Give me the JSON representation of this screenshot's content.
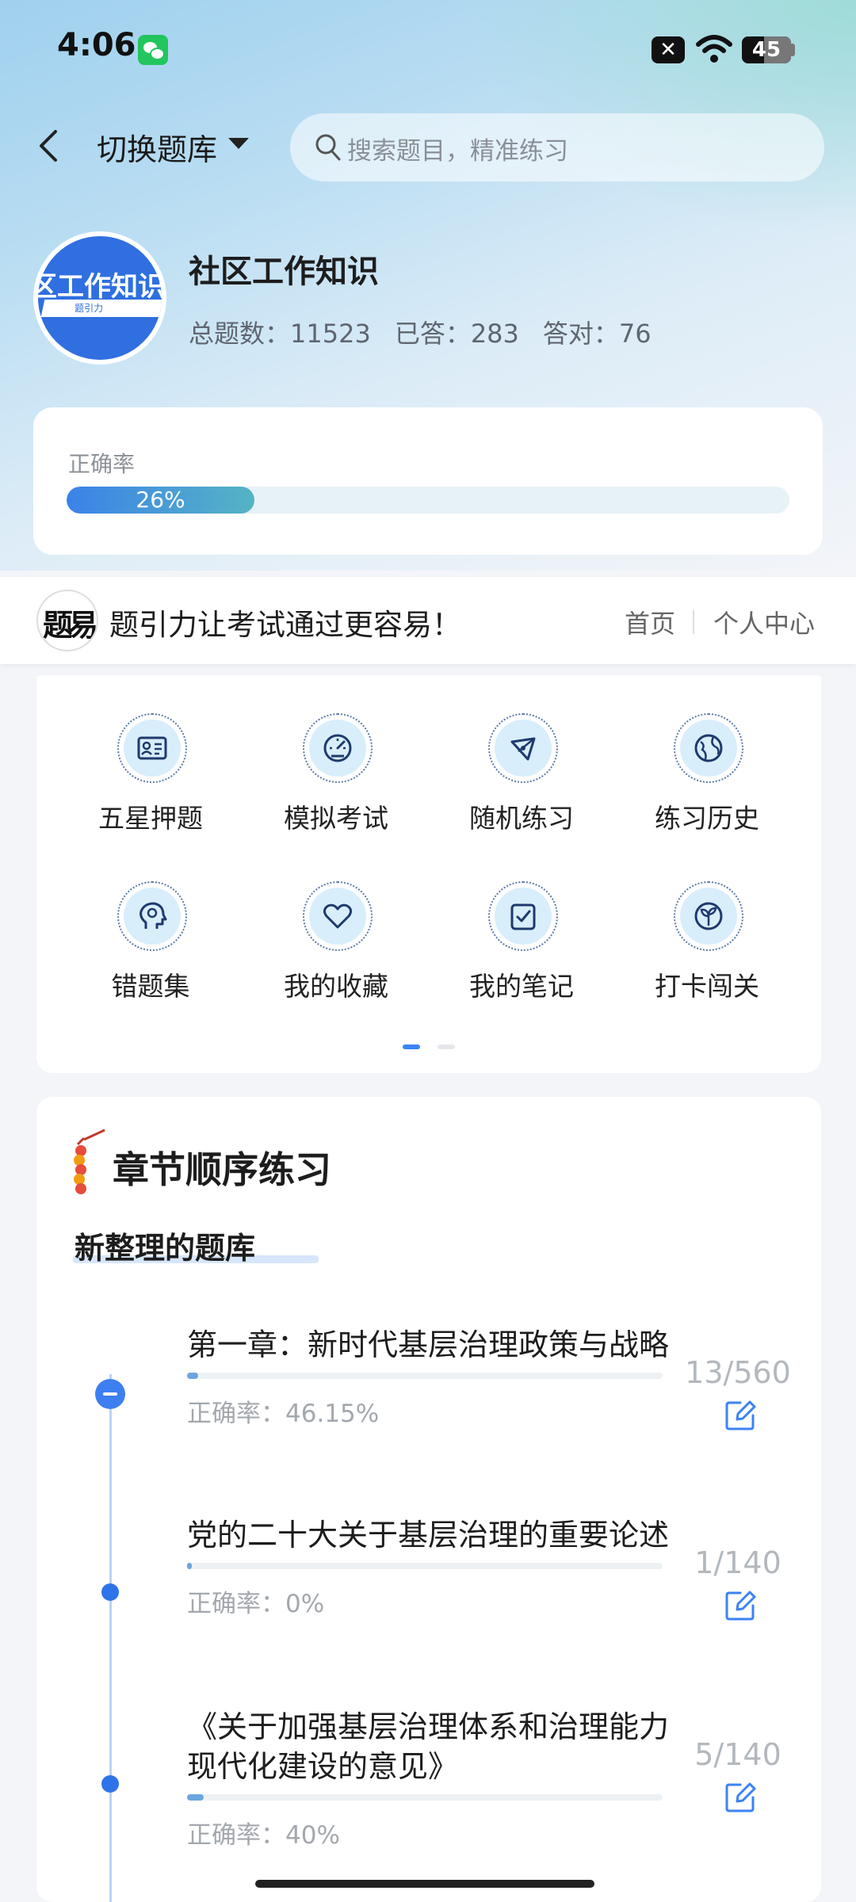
{
  "status_bar": {
    "time": "4:06",
    "battery": "45",
    "notification_x": "✕"
  },
  "nav": {
    "switch_label": "切换题库",
    "search_placeholder": "搜索题目，精准练习"
  },
  "bank": {
    "logo_text": "区工作知识",
    "logo_sub": "题引力",
    "title": "社区工作知识",
    "stats": {
      "total": "总题数：11523",
      "answered": "已答：283",
      "correct": "答对：76"
    }
  },
  "accuracy": {
    "label": "正确率",
    "percent": 26,
    "text": "26%"
  },
  "banner": {
    "logo_glyph": "题易",
    "slogan": "题引力让考试通过更容易！",
    "home": "首页",
    "profile": "个人中心"
  },
  "menu": [
    {
      "label": "五星押题",
      "icon": "id-card-icon"
    },
    {
      "label": "模拟考试",
      "icon": "gauge-icon"
    },
    {
      "label": "随机练习",
      "icon": "random-icon"
    },
    {
      "label": "练习历史",
      "icon": "globe-icon"
    },
    {
      "label": "错题集",
      "icon": "head-icon"
    },
    {
      "label": "我的收藏",
      "icon": "heart-icon"
    },
    {
      "label": "我的笔记",
      "icon": "note-icon"
    },
    {
      "label": "打卡闯关",
      "icon": "sprout-icon"
    }
  ],
  "chapters": {
    "title": "章节顺序练习",
    "subtitle": "新整理的题库",
    "items": [
      {
        "name": "第一章：新时代基层治理政策与战略",
        "count": "13/560",
        "accuracy": "正确率：46.15%",
        "progress": 0.0232
      },
      {
        "name": "党的二十大关于基层治理的重要论述",
        "count": "1/140",
        "accuracy": "正确率：0%",
        "progress": 0.0071
      },
      {
        "name": "《关于加强基层治理体系和治理能力现代化建设的意见》",
        "count": "5/140",
        "accuracy": "正确率：40%",
        "progress": 0.0357
      }
    ]
  },
  "colors": {
    "accent": "#3b82f6",
    "progress_start": "#3b82e8",
    "progress_end": "#55b4c4"
  }
}
